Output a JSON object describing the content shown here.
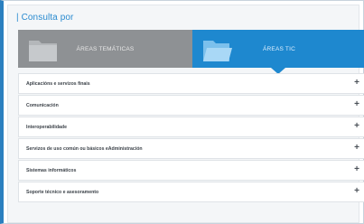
{
  "header": {
    "title": "| Consulta por"
  },
  "tabs": [
    {
      "label": "ÁREAS TEMÁTICAS",
      "icon": "folder-icon"
    },
    {
      "label": "ÁREAS TIC",
      "icon": "folder-open-icon"
    }
  ],
  "items": [
    {
      "label": "Aplicacións e servizos finais",
      "expand": "+"
    },
    {
      "label": "Comunicación",
      "expand": "+"
    },
    {
      "label": "Interoperabilidade",
      "expand": "+"
    },
    {
      "label": "Servizos de uso común ou básicos eAdministración",
      "expand": "+"
    },
    {
      "label": "Sistemas informáticos",
      "expand": "+"
    },
    {
      "label": "Soporte técnico e asesoramento",
      "expand": "+"
    }
  ],
  "colors": {
    "accent": "#1e88cf",
    "tab_inactive": "#8e9194",
    "title": "#2a8bd0"
  }
}
